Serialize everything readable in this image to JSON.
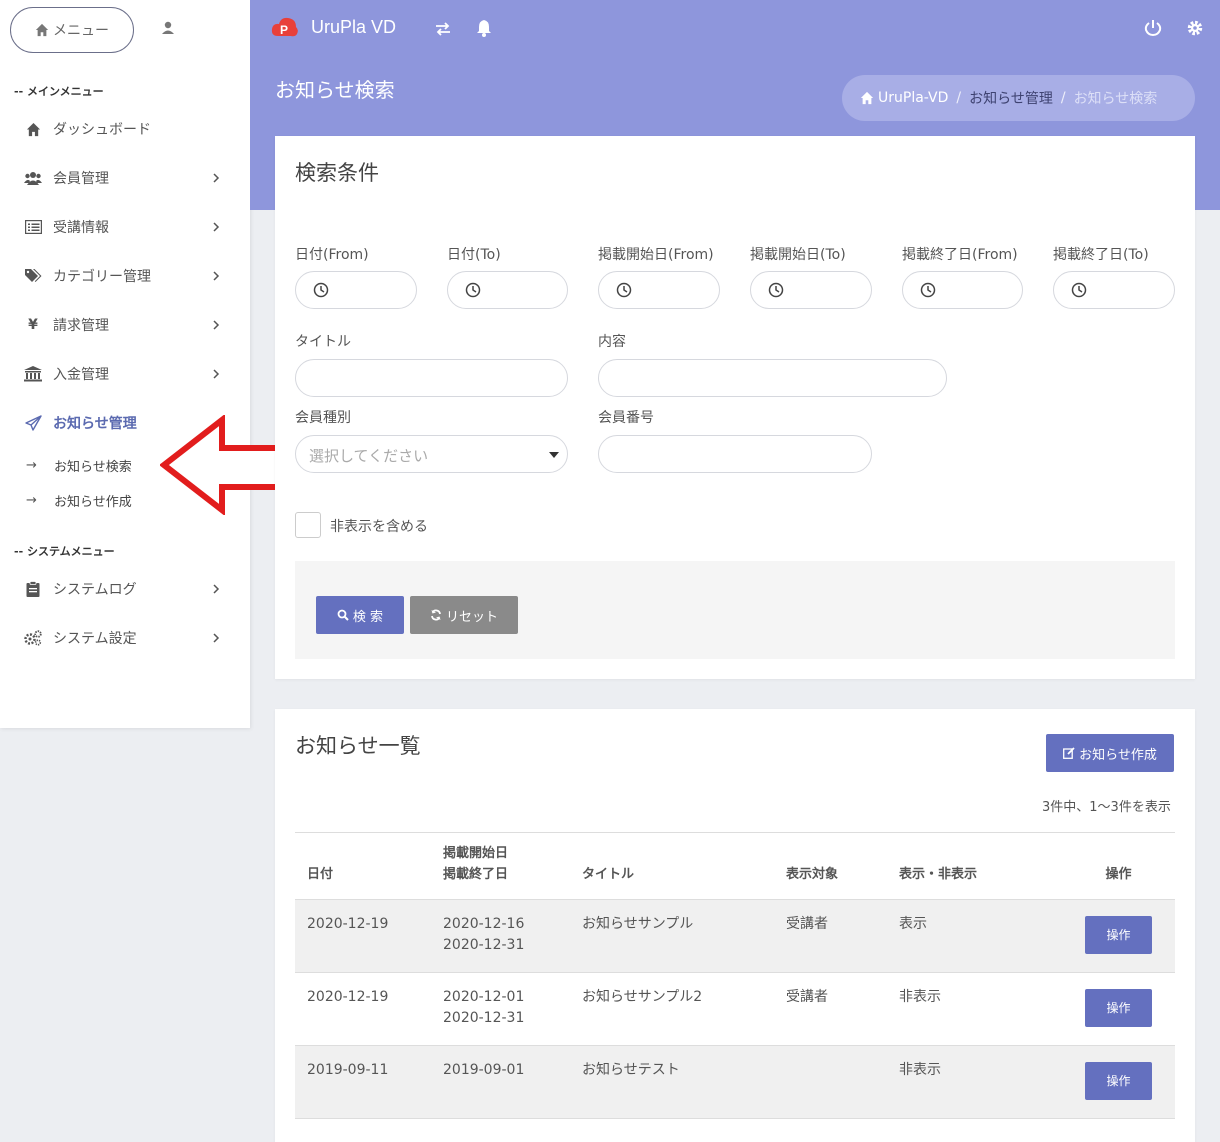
{
  "sidebar": {
    "menu_button": "メニュー",
    "main_menu_title": "-- メインメニュー",
    "system_menu_title": "-- システムメニュー",
    "items": [
      {
        "label": "ダッシュボード"
      },
      {
        "label": "会員管理"
      },
      {
        "label": "受講情報"
      },
      {
        "label": "カテゴリー管理"
      },
      {
        "label": "請求管理"
      },
      {
        "label": "入金管理"
      },
      {
        "label": "お知らせ管理"
      }
    ],
    "sub_items": [
      {
        "label": "お知らせ検索"
      },
      {
        "label": "お知らせ作成"
      }
    ],
    "system_items": [
      {
        "label": "システムログ"
      },
      {
        "label": "システム設定"
      }
    ],
    "arrow_glyph": "→"
  },
  "topbar": {
    "brand": "UruPla VD",
    "accent_color": "#8e96dc",
    "logo_color": "#e8403a"
  },
  "header": {
    "page_title": "お知らせ検索",
    "breadcrumb": [
      "UruPla-VD",
      "お知らせ管理",
      "お知らせ検索"
    ],
    "breadcrumb_sep": "/"
  },
  "search": {
    "title": "検索条件",
    "date_from": "日付(From)",
    "date_to": "日付(To)",
    "pub_start_from": "掲載開始日(From)",
    "pub_start_to": "掲載開始日(To)",
    "pub_end_from": "掲載終了日(From)",
    "pub_end_to": "掲載終了日(To)",
    "title_label": "タイトル",
    "content_label": "内容",
    "member_type_label": "会員種別",
    "member_type_placeholder": "選択してください",
    "member_no_label": "会員番号",
    "include_hidden": "非表示を含める",
    "search_button": "検 索",
    "reset_button": "リセット"
  },
  "list": {
    "title": "お知らせ一覧",
    "create_button": "お知らせ作成",
    "count_text": "3件中、1～3件を表示",
    "columns": {
      "date": "日付",
      "pub_start": "掲載開始日",
      "pub_end": "掲載終了日",
      "title": "タイトル",
      "target": "表示対象",
      "visibility": "表示・非表示",
      "action": "操作"
    },
    "rows": [
      {
        "date": "2020-12-19",
        "pub_start": "2020-12-16",
        "pub_end": "2020-12-31",
        "title": "お知らせサンプル",
        "target": "受講者",
        "visibility": "表示",
        "action": "操作"
      },
      {
        "date": "2020-12-19",
        "pub_start": "2020-12-01",
        "pub_end": "2020-12-31",
        "title": "お知らせサンプル2",
        "target": "受講者",
        "visibility": "非表示",
        "action": "操作"
      },
      {
        "date": "2019-09-11",
        "pub_start": "2019-09-01",
        "pub_end": "",
        "title": "お知らせテスト",
        "target": "",
        "visibility": "非表示",
        "action": "操作"
      }
    ]
  }
}
